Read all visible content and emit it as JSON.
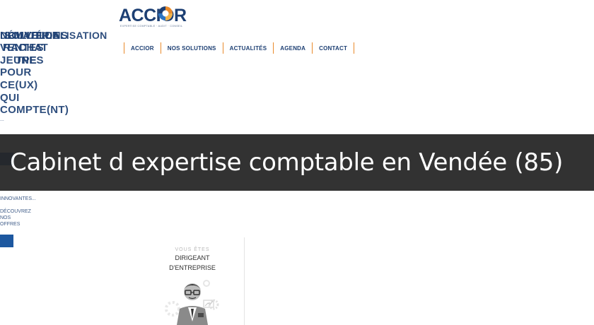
{
  "header": {
    "logo_text": "ACCIOR",
    "logo_tagline": "EXPERTISE COMPTABLE · AUDIT · CONSEIL"
  },
  "nav": {
    "items": [
      {
        "label": "ACCIOR"
      },
      {
        "label": "NOS SOLUTIONS"
      },
      {
        "label": "ACTUALITÉS"
      },
      {
        "label": "AGENDA"
      },
      {
        "label": "CONTACT"
      }
    ]
  },
  "sidebar": {
    "overlapping_titles": [
      "NOUVELLE",
      "SOLUTIONS",
      "DÉMATÉRIALISATION",
      "VENTES",
      "RACHAT",
      "JEUNES",
      "TPE",
      "POUR",
      "CE(UX)",
      "QUI",
      "COMPTE(NT)"
    ],
    "fragments": [
      "...",
      "INNOVANTES...",
      "DÉCOUVREZ",
      "NOS",
      "OFFRES"
    ]
  },
  "banner": {
    "title": "Cabinet d expertise comptable en Vendée (85)"
  },
  "profile": {
    "pre_label": "VOUS ÊTES",
    "title_line1": "DIRIGEANT",
    "title_line2": "D'ENTREPRISE"
  },
  "colors": {
    "brand_blue": "#1d3f73",
    "accent_orange": "#e98a2b",
    "banner_bg": "#262626"
  }
}
